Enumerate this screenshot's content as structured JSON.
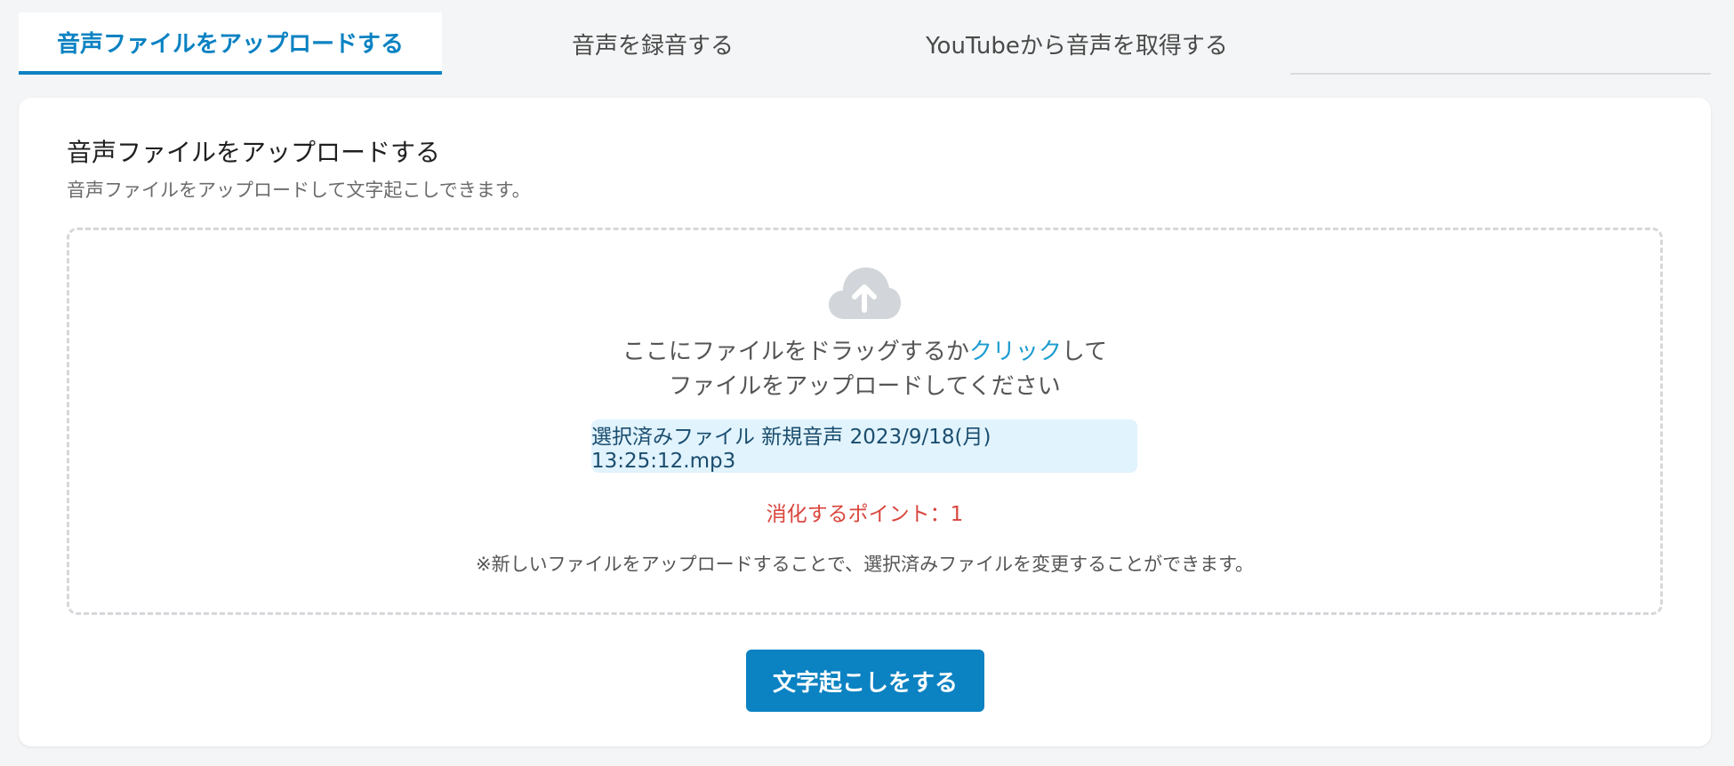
{
  "tabs": [
    {
      "label": "音声ファイルをアップロードする",
      "active": true
    },
    {
      "label": "音声を録音する",
      "active": false
    },
    {
      "label": "YouTubeから音声を取得する",
      "active": false
    }
  ],
  "card": {
    "title": "音声ファイルをアップロードする",
    "subtitle": "音声ファイルをアップロードして文字起こしできます。"
  },
  "dropzone": {
    "icon": "cloud-upload-icon",
    "line1_before": "ここにファイルをドラッグするか",
    "line1_link": "クリック",
    "line1_after": "して",
    "line2": "ファイルをアップロードしてください",
    "selected_file": "選択済みファイル 新規音声 2023/9/18(月) 13:25:12.mp3",
    "points": "消化するポイント：1",
    "note": "※新しいファイルをアップロードすることで、選択済みファイルを変更することができます。"
  },
  "submit_label": "文字起こしをする",
  "colors": {
    "accent": "#0b82c2",
    "link": "#1a9ccf",
    "points": "#d9453d",
    "file_bg": "#e1f3fd"
  }
}
